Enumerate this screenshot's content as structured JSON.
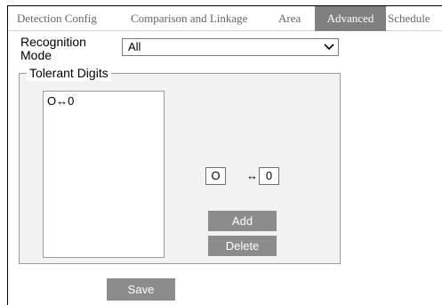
{
  "tabs": [
    {
      "label": "Detection Config",
      "active": false
    },
    {
      "label": "Comparison and Linkage",
      "active": false
    },
    {
      "label": "Area",
      "active": false
    },
    {
      "label": "Advanced",
      "active": true
    },
    {
      "label": "Schedule",
      "active": false
    }
  ],
  "recognition_mode": {
    "label": "Recognition Mode",
    "selected": "All"
  },
  "tolerant_digits": {
    "legend": "Tolerant Digits",
    "items": [
      "O↔0"
    ],
    "input_left": "O",
    "arrow": "↔",
    "input_right": "0",
    "add_label": "Add",
    "delete_label": "Delete"
  },
  "save_label": "Save",
  "colors": {
    "active_tab_bg": "#808080",
    "button_bg": "#8c8c8c",
    "panel_bg": "#f2f2f2"
  }
}
